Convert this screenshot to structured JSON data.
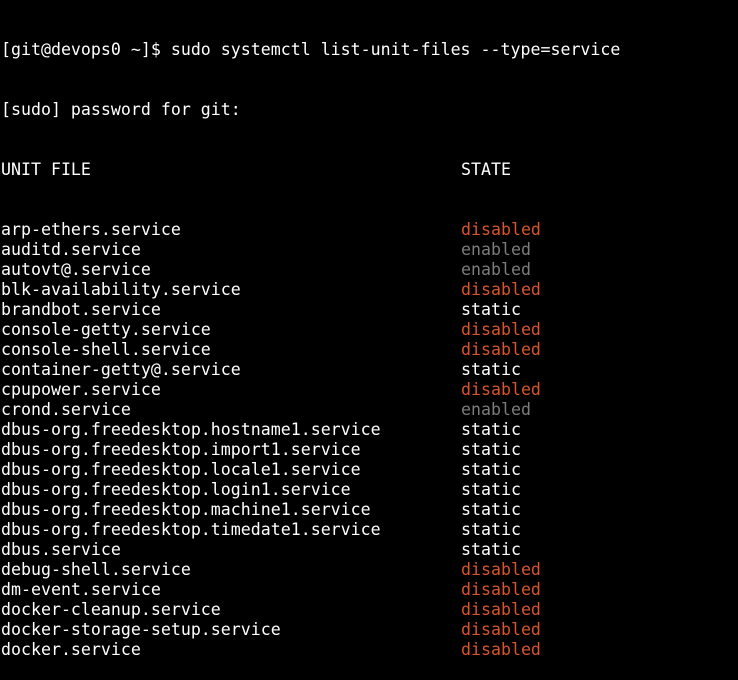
{
  "terminal": {
    "prompt_line": "[git@devops0 ~]$ sudo systemctl list-unit-files --type=service",
    "sudo_line": "[sudo] password for git:",
    "header": {
      "unit": "UNIT FILE",
      "state": "STATE"
    },
    "rows": [
      {
        "unit": "arp-ethers.service",
        "state": "disabled"
      },
      {
        "unit": "auditd.service",
        "state": "enabled"
      },
      {
        "unit": "autovt@.service",
        "state": "enabled"
      },
      {
        "unit": "blk-availability.service",
        "state": "disabled"
      },
      {
        "unit": "brandbot.service",
        "state": "static"
      },
      {
        "unit": "console-getty.service",
        "state": "disabled"
      },
      {
        "unit": "console-shell.service",
        "state": "disabled"
      },
      {
        "unit": "container-getty@.service",
        "state": "static"
      },
      {
        "unit": "cpupower.service",
        "state": "disabled"
      },
      {
        "unit": "crond.service",
        "state": "enabled"
      },
      {
        "unit": "dbus-org.freedesktop.hostname1.service",
        "state": "static"
      },
      {
        "unit": "dbus-org.freedesktop.import1.service",
        "state": "static"
      },
      {
        "unit": "dbus-org.freedesktop.locale1.service",
        "state": "static"
      },
      {
        "unit": "dbus-org.freedesktop.login1.service",
        "state": "static"
      },
      {
        "unit": "dbus-org.freedesktop.machine1.service",
        "state": "static"
      },
      {
        "unit": "dbus-org.freedesktop.timedate1.service",
        "state": "static"
      },
      {
        "unit": "dbus.service",
        "state": "static"
      },
      {
        "unit": "debug-shell.service",
        "state": "disabled"
      },
      {
        "unit": "dm-event.service",
        "state": "disabled"
      },
      {
        "unit": "docker-cleanup.service",
        "state": "disabled"
      },
      {
        "unit": "docker-storage-setup.service",
        "state": "disabled"
      },
      {
        "unit": "docker.service",
        "state": "disabled"
      }
    ]
  },
  "colors": {
    "background": "#000000",
    "text": "#ffffff",
    "disabled": "#d9542d",
    "enabled": "#7c7c7c"
  }
}
